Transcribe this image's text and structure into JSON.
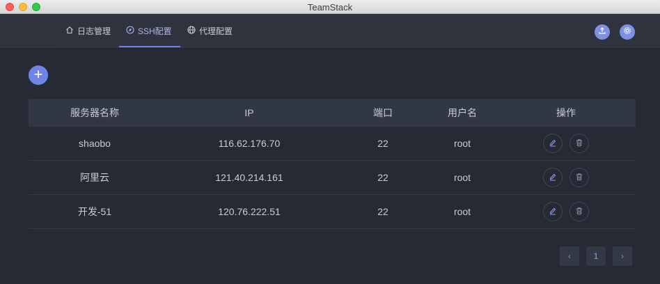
{
  "window": {
    "title": "TeamStack"
  },
  "nav": {
    "tabs": [
      {
        "label": "日志管理",
        "icon": "home-icon"
      },
      {
        "label": "SSH配置",
        "icon": "compass-icon"
      },
      {
        "label": "代理配置",
        "icon": "globe-icon"
      }
    ],
    "active_tab": 1,
    "actions": [
      {
        "icon": "upload-icon"
      },
      {
        "icon": "gear-icon"
      }
    ]
  },
  "add_button": {
    "label": "+"
  },
  "table": {
    "headers": [
      "服务器名称",
      "IP",
      "端口",
      "用户名",
      "操作"
    ],
    "rows": [
      {
        "name": "shaobo",
        "ip": "116.62.176.70",
        "port": "22",
        "user": "root"
      },
      {
        "name": "阿里云",
        "ip": "121.40.214.161",
        "port": "22",
        "user": "root"
      },
      {
        "name": "开发-51",
        "ip": "120.76.222.51",
        "port": "22",
        "user": "root"
      }
    ]
  },
  "pagination": {
    "prev": "‹",
    "current": "1",
    "next": "›"
  },
  "colors": {
    "accent": "#7084e3",
    "background": "#262a34",
    "header_bg": "#323744"
  }
}
